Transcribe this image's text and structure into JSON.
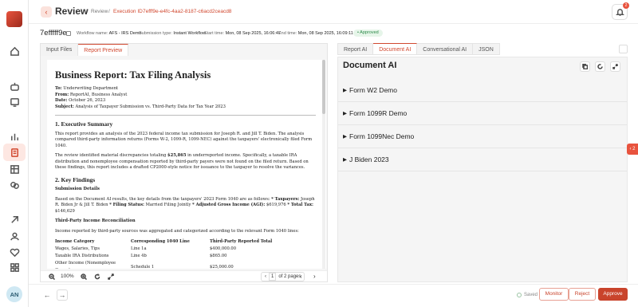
{
  "header": {
    "title": "Review",
    "breadcrumb_review": "Review",
    "separator": "/",
    "execution_label": "Execution ID",
    "execution_id": "7efff9e-e4fc-4aa2-8187-c6acd2ceacd8",
    "notification_count": "2"
  },
  "workflow": {
    "short_id": "7efffff9e",
    "name_label": "Workflow name:",
    "name_value": "AFS - IRS Demo",
    "type_label": "Submission type:",
    "type_value": "Instant Workflow",
    "start_label": "Start time:",
    "start_value": "Mon, 08 Sep 2025, 16:06:47",
    "end_label": "End time:",
    "end_value": "Mon, 08 Sep 2025, 16:09:11",
    "status": "• Approved",
    "status_color": "#2d8a4a"
  },
  "left_tabs": [
    "Input Files",
    "Report Preview"
  ],
  "report": {
    "title": "Business Report: Tax Filing Analysis",
    "to_label": "To:",
    "to_value": "Underwriting Department",
    "from_label": "From:",
    "from_value": "ReportAI, Business Analyst",
    "date_label": "Date:",
    "date_value": "October 26, 2023",
    "subject_label": "Subject:",
    "subject_value": "Analysis of Taxpayer Submission vs. Third-Party Data for Tax Year 2023",
    "s1_heading": "1. Executive Summary",
    "s1_p1": "This report provides an analysis of the 2023 federal income tax submission for Joseph R. and Jill T. Biden. The analysis compared third-party information returns (Forms W-2, 1099-R, 1099-NEC) against the taxpayers' electronically filed Form 1040.",
    "s1_p2a": "The review identified material discrepancies totaling ",
    "s1_p2_amount": "$25,865",
    "s1_p2b": " in underreported income. Specifically, a taxable IRA distribution and nonemployee compensation reported by third-party payers were not found on the filed return. Based on these findings, this report includes a drafted CP2000-style notice for issuance to the taxpayer to resolve the variances.",
    "s2_heading": "2. Key Findings",
    "sub1": "Submission Details",
    "sub1_p_a": "Based on the Document AI results, the key details from the taxpayers' 2023 Form 1040 are as follows: ",
    "taxpayers_label": "* Taxpayers:",
    "taxpayers_value": " Joseph R. Biden Jr & Jill T. Biden ",
    "filing_label": "* Filing Status:",
    "filing_value": " Married Filing Jointly ",
    "agi_label": "* Adjusted Gross Income (AGI):",
    "agi_value": " $619,976 ",
    "total_tax_label": "* Total Tax:",
    "total_tax_value": " $146,629",
    "sub2": "Third-Party Income Reconciliation",
    "sub2_p": "Income reported by third-party sources was aggregated and categorized according to the relevant Form 1040 lines:",
    "table_headers": [
      "Income Category",
      "Corresponding 1040 Line",
      "Third-Party Reported Total"
    ],
    "table_rows": [
      [
        "Wages, Salaries, Tips",
        "Line 1a",
        "$400,000.00"
      ],
      [
        "Taxable IRA Distributions",
        "Line 4b",
        "$865.00"
      ],
      [
        "Other Income (Nonemployee Comp.)",
        "Schedule 1",
        "$25,000.00"
      ]
    ]
  },
  "viewer": {
    "zoom": "100%",
    "page_current": "1",
    "page_of": "of 2 pages"
  },
  "right_tabs": [
    "Report AI",
    "Document AI",
    "Conversational AI",
    "JSON"
  ],
  "document_ai": {
    "title": "Document AI",
    "sections": [
      "Form W2 Demo",
      "Form 1099R Demo",
      "Form 1099Nec Demo",
      "J Biden 2023"
    ]
  },
  "side_tab_label": "‹ 2",
  "footer": {
    "saved": "Saved",
    "monitor": "Monitor",
    "reject": "Reject",
    "approve": "Approve"
  },
  "user": {
    "initials": "AN"
  },
  "colors": {
    "accent": "#d1482f",
    "approve": "#c9442c"
  }
}
